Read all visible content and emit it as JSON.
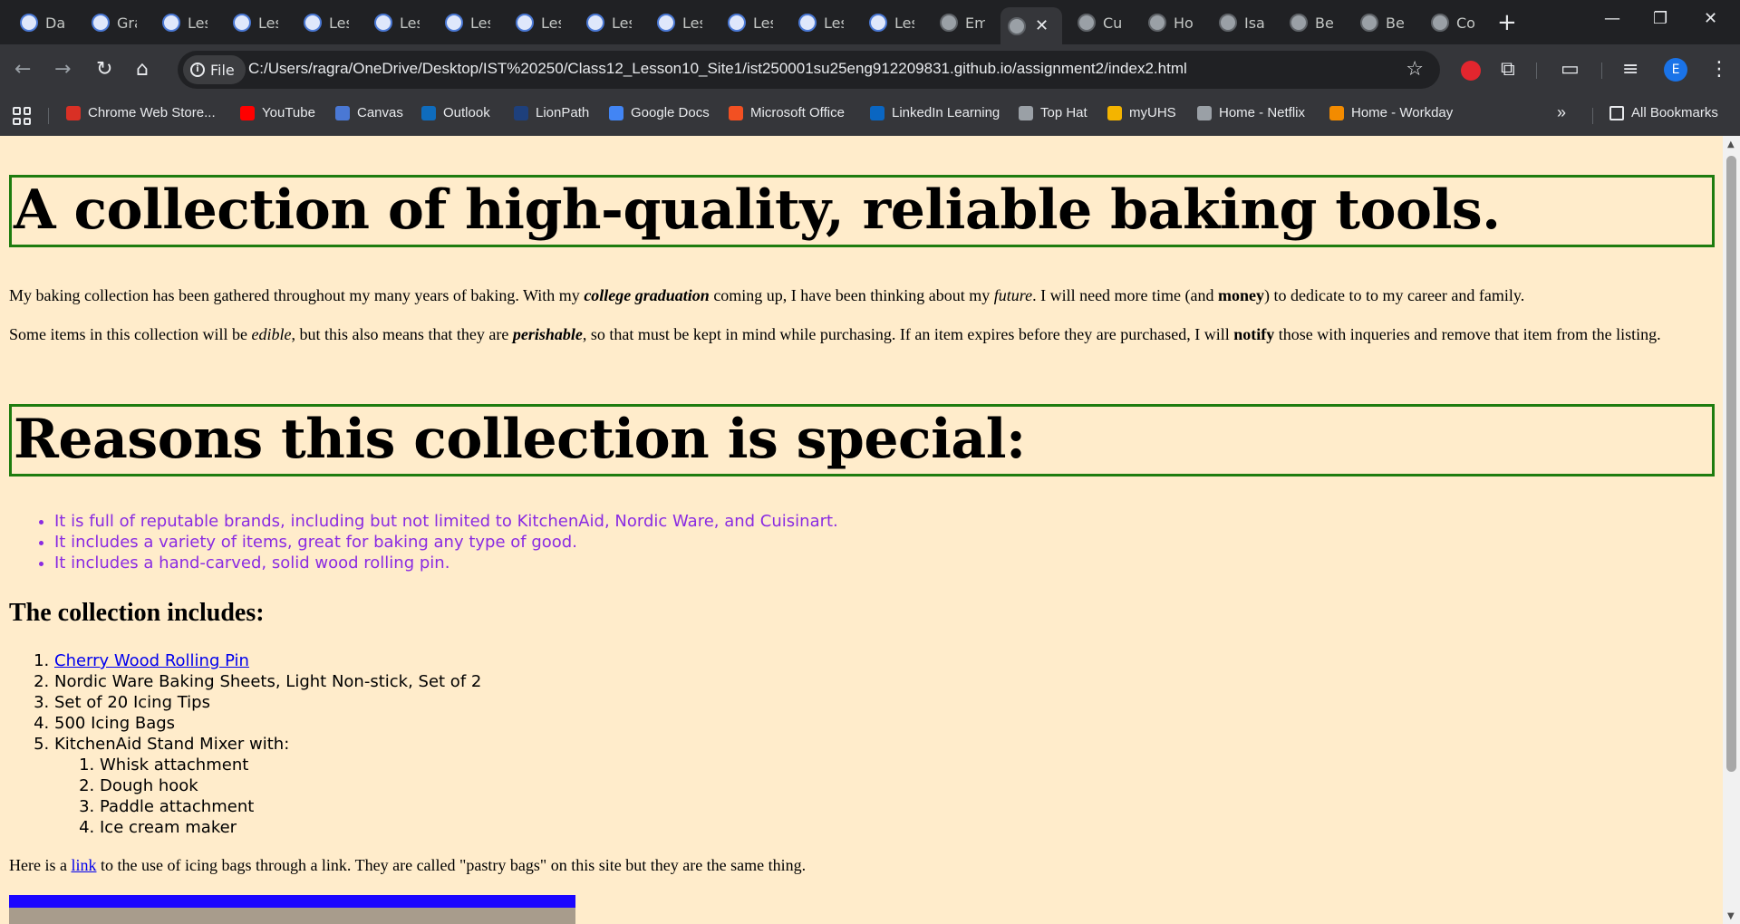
{
  "browser": {
    "tabs": [
      {
        "label": "Da",
        "icon": "doc"
      },
      {
        "label": "Gra",
        "icon": "doc"
      },
      {
        "label": "Les",
        "icon": "doc"
      },
      {
        "label": "Les",
        "icon": "doc"
      },
      {
        "label": "Les",
        "icon": "doc"
      },
      {
        "label": "Les",
        "icon": "doc"
      },
      {
        "label": "Les",
        "icon": "doc"
      },
      {
        "label": "Les",
        "icon": "doc"
      },
      {
        "label": "Les",
        "icon": "doc"
      },
      {
        "label": "Les",
        "icon": "doc"
      },
      {
        "label": "Les",
        "icon": "doc"
      },
      {
        "label": "Les",
        "icon": "doc"
      },
      {
        "label": "Les",
        "icon": "doc"
      },
      {
        "label": "Em",
        "icon": "globe"
      },
      {
        "label": "",
        "icon": "globe"
      },
      {
        "label": "Cu",
        "icon": "globe"
      },
      {
        "label": "Ho",
        "icon": "globe"
      },
      {
        "label": "Isa",
        "icon": "globe"
      },
      {
        "label": "Be",
        "icon": "globe"
      },
      {
        "label": "Be",
        "icon": "globe"
      },
      {
        "label": "Co",
        "icon": "globe"
      }
    ],
    "active_tab_index": 14,
    "new_tab": "+",
    "window_controls": {
      "minimize": "—",
      "restore": "❐",
      "close": "✕"
    },
    "omnibox": {
      "chip": "File",
      "url": "C:/Users/ragra/OneDrive/Desktop/IST%20250/Class12_Lesson10_Site1/ist250001su25eng912209831.github.io/assignment2/index2.html"
    },
    "profile_initial": "E",
    "bookmarks": [
      {
        "label": "Chrome Web Store...",
        "color": "#d93025"
      },
      {
        "label": "YouTube",
        "color": "#ff0000"
      },
      {
        "label": "Canvas",
        "color": "#4a78d4"
      },
      {
        "label": "Outlook",
        "color": "#0f6cbd"
      },
      {
        "label": "LionPath",
        "color": "#1e407c"
      },
      {
        "label": "Google Docs",
        "color": "#4285f4"
      },
      {
        "label": "Microsoft Office",
        "color": "#f25022"
      },
      {
        "label": "LinkedIn Learning",
        "color": "#0a66c2"
      },
      {
        "label": "Top Hat",
        "color": "#9aa0a6"
      },
      {
        "label": "myUHS",
        "color": "#f4b400"
      },
      {
        "label": "Home - Netflix",
        "color": "#9aa0a6"
      },
      {
        "label": "Home - Workday",
        "color": "#f38b00"
      }
    ],
    "bookmarks_overflow": "»",
    "all_bookmarks": "All Bookmarks"
  },
  "page": {
    "heading1": "A collection of high-quality, reliable baking tools.",
    "para1": {
      "a": "My baking collection has been gathered throughout my many years of baking. With my ",
      "b": "college graduation",
      "c": " coming up, I have been thinking about my ",
      "d": "future",
      "e": ". I will need more time (and ",
      "f": "money",
      "g": ") to dedicate to to my career and family."
    },
    "para2": {
      "a": "Some items in this collection will be ",
      "b": "edible",
      "c": ", but this also means that they are ",
      "d": "perishable",
      "e": ", so that must be kept in mind while purchasing. If an item expires before they are purchased, I will ",
      "f": "notify",
      "g": " those with inqueries and remove that item from the listing."
    },
    "heading2": "Reasons this collection is special:",
    "reasons": [
      "It is full of reputable brands, including but not limited to KitchenAid, Nordic Ware, and Cuisinart.",
      "It includes a variety of items, great for baking any type of good.",
      "It includes a hand-carved, solid wood rolling pin."
    ],
    "heading3": "The collection includes:",
    "items": {
      "first_link": "Cherry Wood Rolling Pin",
      "i2": "Nordic Ware Baking Sheets, Light Non-stick, Set of 2",
      "i3": "Set of 20 Icing Tips",
      "i4": "500 Icing Bags",
      "i5": "KitchenAid Stand Mixer with:",
      "sub": [
        "Whisk attachment",
        "Dough hook",
        "Paddle attachment",
        "Ice cream maker"
      ]
    },
    "para3": {
      "a": "Here is a ",
      "link": "link",
      "b": " to the use of icing bags through a link. They are called \"pastry bags\" on this site but they are the same thing."
    }
  }
}
